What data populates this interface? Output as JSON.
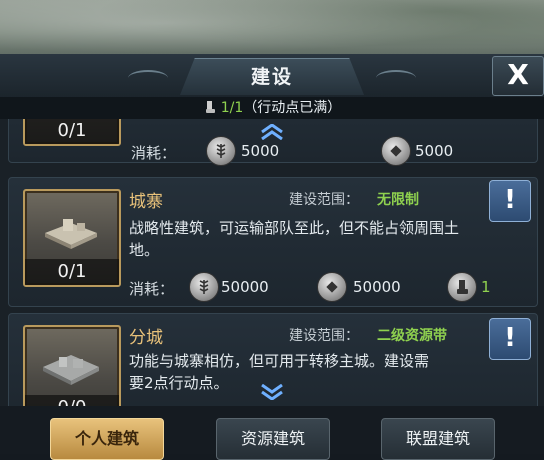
{
  "header": {
    "title": "建设",
    "close_label": "X"
  },
  "action_points": {
    "current": "1/1",
    "status": "（行动点已满）"
  },
  "cards": [
    {
      "count": "0/1",
      "cost_label": "消耗：",
      "food_cost": "5000",
      "silver_cost": "5000"
    },
    {
      "name": "城寨",
      "count": "0/1",
      "scope_label": "建设范围：",
      "scope_value": "无限制",
      "description": "战略性建筑，可运输部队至此，但不能占领周围土地。",
      "cost_label": "消耗：",
      "food_cost": "50000",
      "silver_cost": "50000",
      "ap_cost": "1",
      "info_label": "!"
    },
    {
      "name": "分城",
      "count": "0/0",
      "scope_label": "建设范围：",
      "scope_value": "二级资源带",
      "description": "功能与城寨相仿，但可用于转移主城。建设需要2点行动点。",
      "info_label": "!"
    }
  ],
  "tabs": [
    {
      "label": "个人建筑",
      "active": true
    },
    {
      "label": "资源建筑",
      "active": false
    },
    {
      "label": "联盟建筑",
      "active": false
    }
  ],
  "icons": {
    "food": "wheat-icon",
    "silver": "coin-icon",
    "action_point": "boot-icon",
    "scroll_up": "chevron-up-icon",
    "scroll_down": "chevron-down-icon"
  },
  "colors": {
    "accent_gold": "#e9c27a",
    "green": "#8fd14f",
    "info_blue": "#3b5f8c"
  }
}
